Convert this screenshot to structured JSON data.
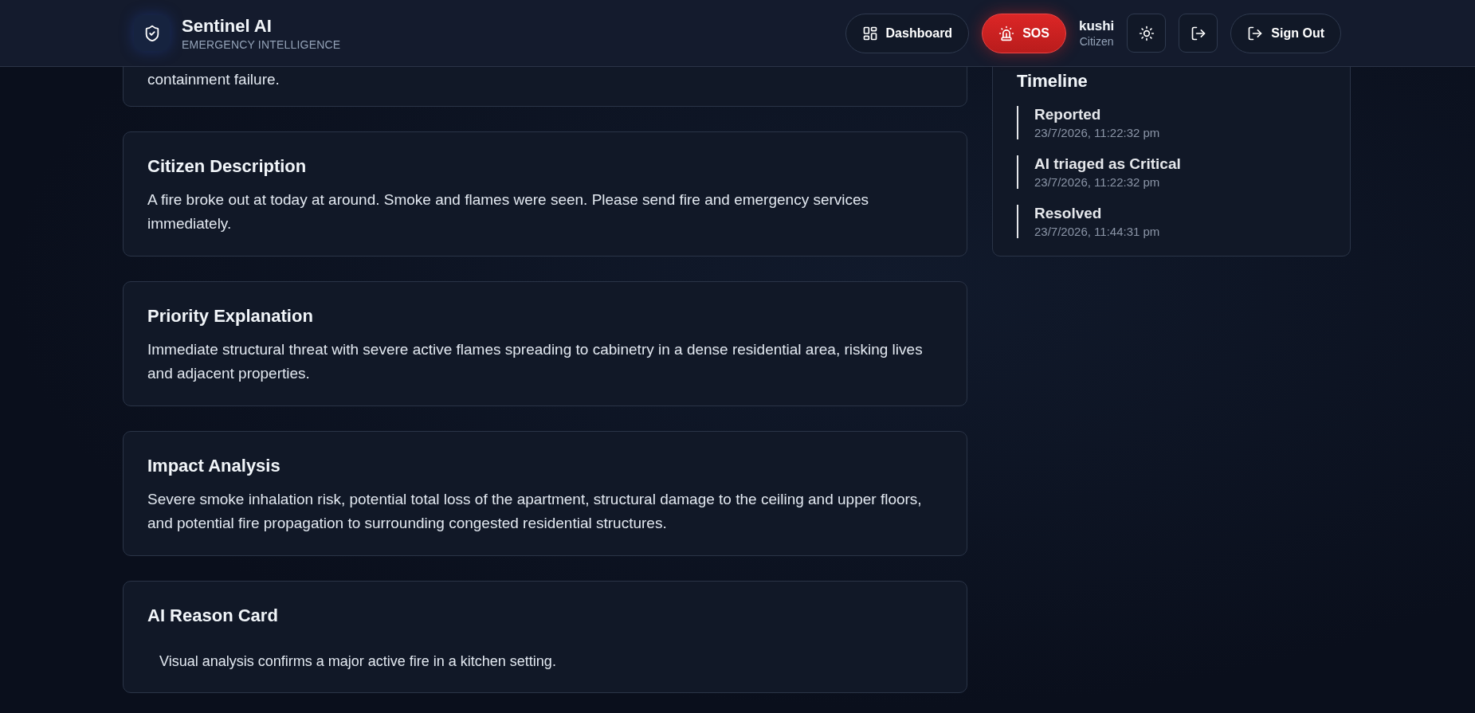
{
  "header": {
    "brand": {
      "title": "Sentinel AI",
      "subtitle": "EMERGENCY INTELLIGENCE"
    },
    "nav": [
      {
        "kind": "dashboard",
        "label": "Dashboard"
      },
      {
        "kind": "sos",
        "label": "SOS"
      }
    ],
    "user": {
      "name": "kushi",
      "role": "Citizen"
    },
    "actions": [
      {
        "kind": "theme"
      },
      {
        "kind": "exit"
      },
      {
        "kind": "signout",
        "label": "Sign Out"
      }
    ]
  },
  "sections": [
    {
      "kind": "plain",
      "body": "containment failure."
    },
    {
      "kind": "plain",
      "title": "Citizen Description",
      "body": "A fire broke out at today at around. Smoke and flames were seen. Please send fire and emergency services immediately."
    },
    {
      "kind": "plain",
      "title": "Priority Explanation",
      "body": "Immediate structural threat with severe active flames spreading to cabinetry in a dense residential area, risking lives and adjacent properties."
    },
    {
      "kind": "plain",
      "title": "Impact Analysis",
      "body": "Severe smoke inhalation risk, potential total loss of the apartment, structural damage to the ceiling and upper floors, and potential fire propagation to surrounding congested residential structures."
    },
    {
      "kind": "reason",
      "title": "AI Reason Card",
      "body": "Visual analysis confirms a major active fire in a kitchen setting."
    }
  ],
  "timeline": {
    "title": "Timeline",
    "events": [
      {
        "label": "Reported",
        "time": "23/7/2026, 11:22:32 pm"
      },
      {
        "label": "AI triaged as Critical",
        "time": "23/7/2026, 11:22:32 pm"
      },
      {
        "label": "Resolved",
        "time": "23/7/2026, 11:44:31 pm"
      }
    ]
  }
}
